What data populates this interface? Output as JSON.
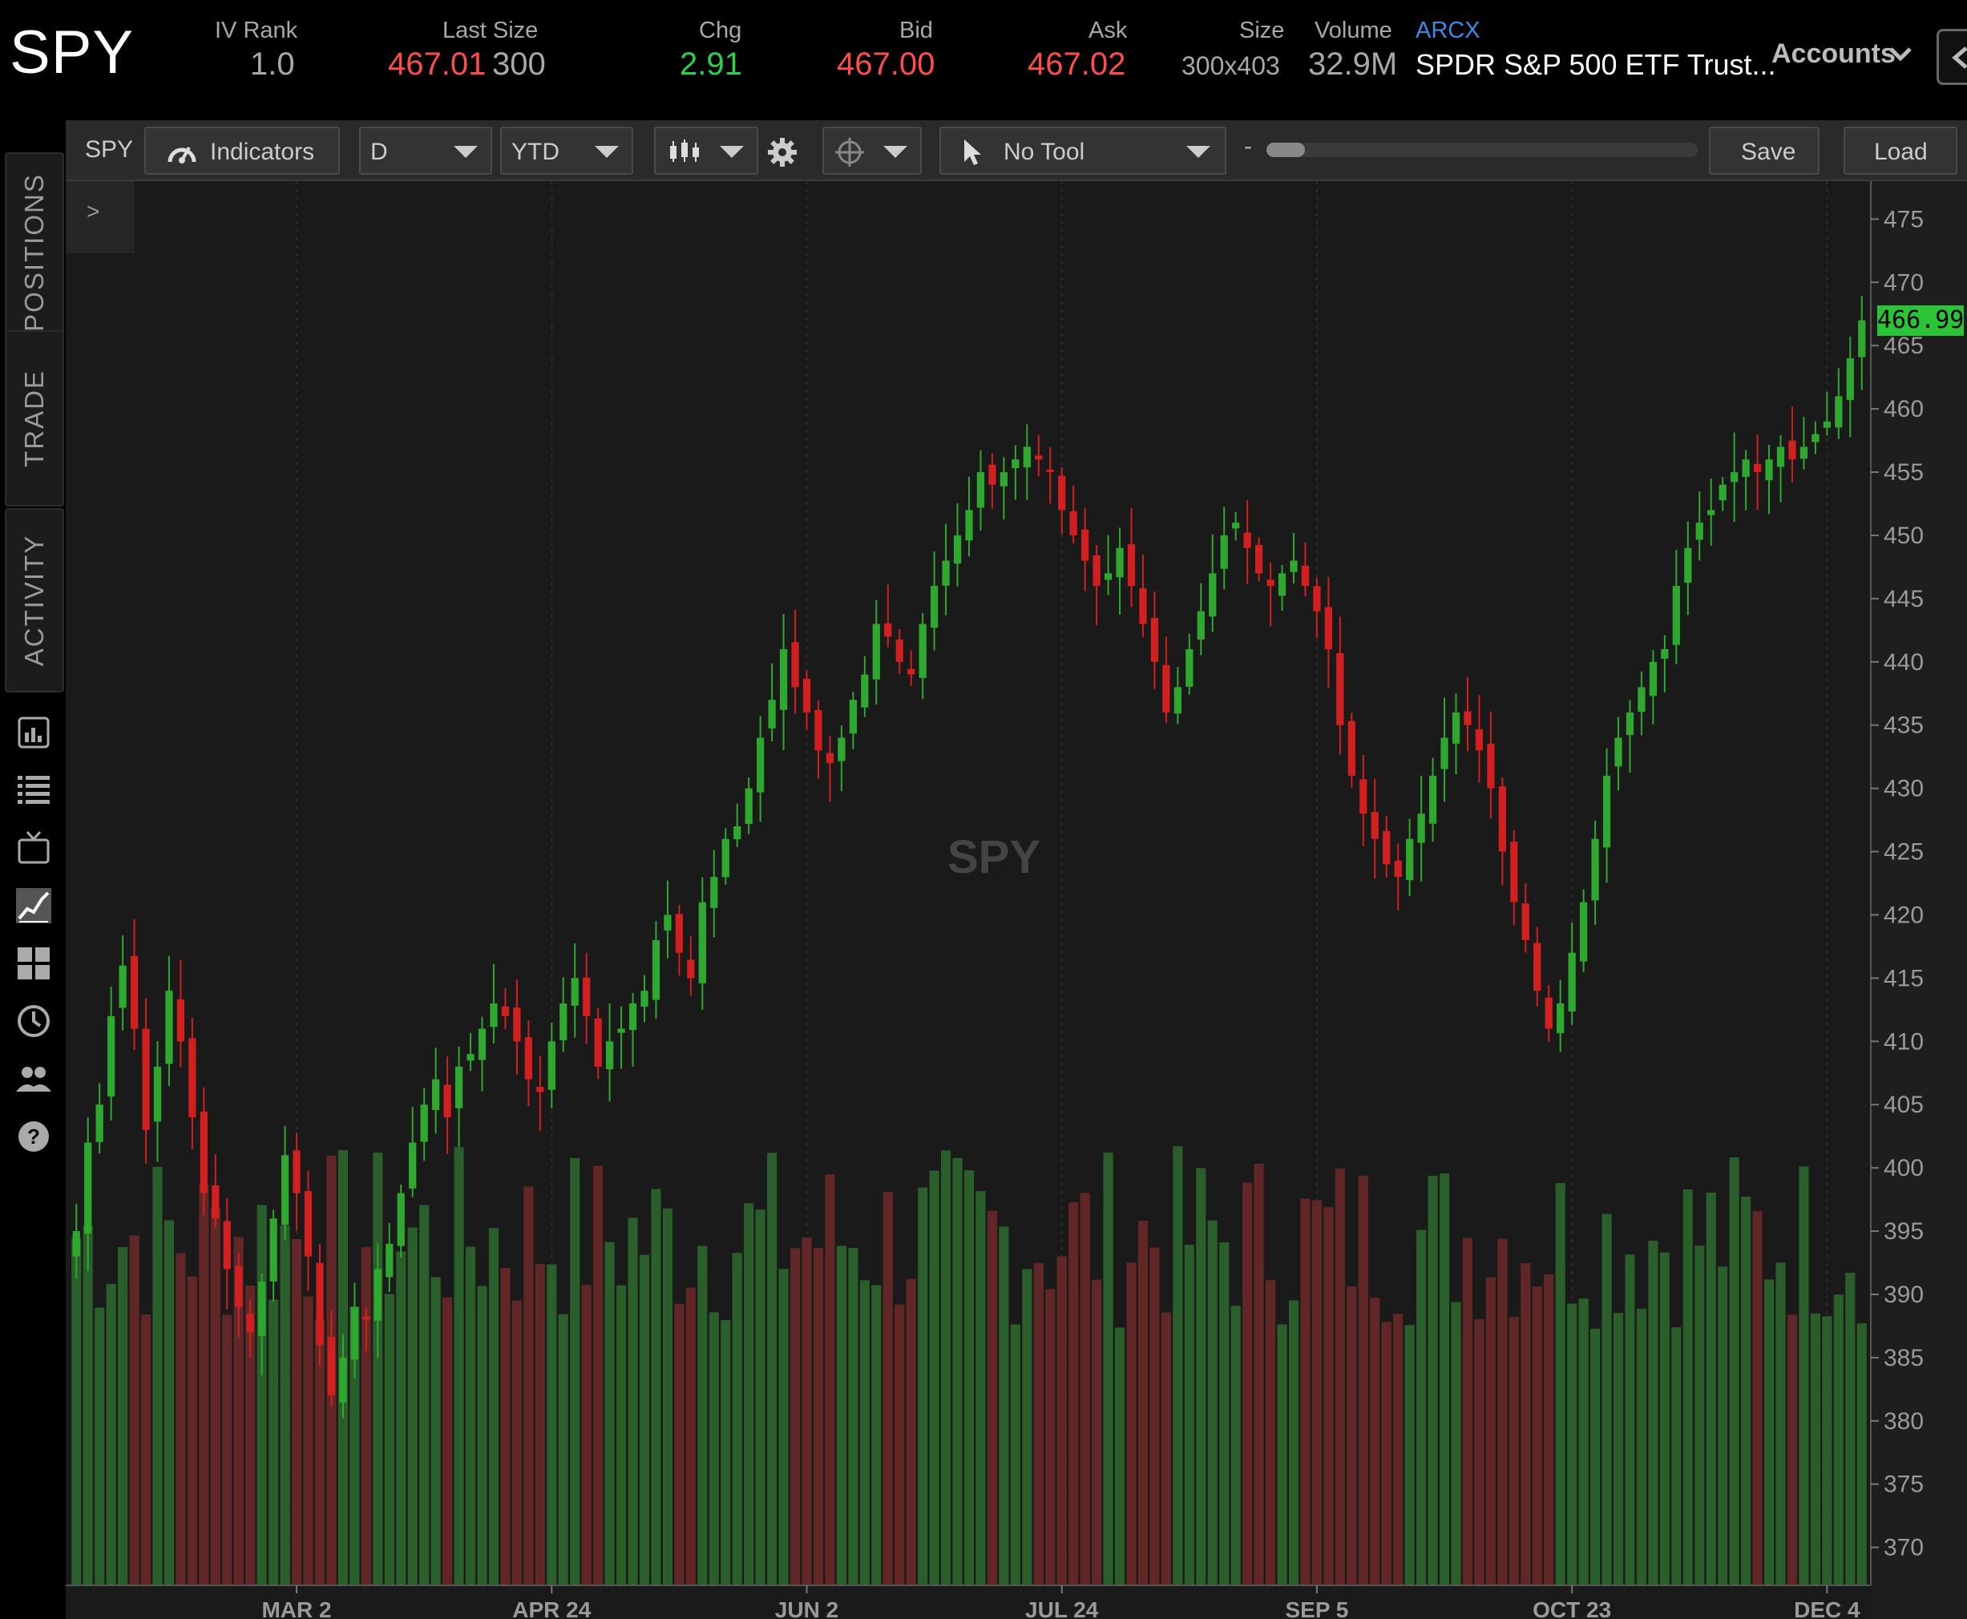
{
  "header": {
    "symbol": "SPY",
    "iv_rank": {
      "label": "IV Rank",
      "value": "1.0"
    },
    "last_size": {
      "label": "Last Size",
      "last": "467.01",
      "size": "300"
    },
    "chg": {
      "label": "Chg",
      "value": "2.91"
    },
    "bid": {
      "label": "Bid",
      "value": "467.00"
    },
    "ask": {
      "label": "Ask",
      "value": "467.02"
    },
    "size": {
      "label": "Size",
      "value": "300x403"
    },
    "volume": {
      "label": "Volume",
      "value": "32.9M"
    },
    "exchange": "ARCX",
    "description": "SPDR S&P 500 ETF Trust...",
    "accounts": "Accounts"
  },
  "sidebar": {
    "tabs": [
      "POSITIONS",
      "TRADE",
      "ACTIVITY"
    ],
    "icons": [
      "dashboard-icon",
      "list-icon",
      "tv-icon",
      "chart-icon",
      "grid-icon",
      "history-icon",
      "community-icon",
      "help-icon"
    ]
  },
  "toolbar": {
    "symbol": "SPY",
    "indicators": "Indicators",
    "aggregation": "D",
    "range": "YTD",
    "tool": "No Tool",
    "zoom_minus": "-",
    "zoom_plus": "+",
    "zoom_level": 0.09,
    "save": "Save",
    "load": "Load"
  },
  "chart": {
    "watermark": "SPY",
    "collapse": ">",
    "last_price_tag": "466.99",
    "colors": {
      "up": "#2fa82f",
      "down": "#d21f1f",
      "vol_up": "#2e6b2e",
      "vol_down": "#6e2a2a",
      "background": "#1a1a1a"
    }
  },
  "chart_data": {
    "type": "candlestick",
    "title": "SPY",
    "y_ticks": [
      475,
      470,
      465,
      460,
      455,
      450,
      445,
      440,
      435,
      430,
      425,
      420,
      415,
      410,
      405,
      400,
      395,
      390,
      385,
      380,
      375,
      370
    ],
    "x_ticks": [
      "MAR 2",
      "APR 24",
      "JUN 2",
      "JUL 24",
      "SEP 5",
      "OCT 23",
      "DEC 4"
    ],
    "ylim": [
      367,
      478
    ],
    "last_price": 466.99,
    "closes": [
      395,
      402,
      405,
      412,
      416,
      411,
      403,
      408,
      414,
      410,
      404,
      398,
      396,
      392,
      389,
      387,
      391,
      396,
      401,
      398,
      393,
      386,
      382,
      385,
      389,
      388,
      392,
      394,
      398,
      402,
      405,
      407,
      404,
      408,
      409,
      411,
      413,
      412,
      410,
      407,
      406,
      410,
      413,
      415,
      412,
      408,
      410,
      411,
      413,
      414,
      418,
      420,
      417,
      415,
      421,
      423,
      426,
      427,
      430,
      434,
      437,
      441,
      438,
      436,
      433,
      432,
      434,
      437,
      439,
      443,
      442,
      440,
      439,
      443,
      446,
      448,
      450,
      452,
      455,
      454,
      455,
      456,
      457,
      456,
      455,
      452,
      450,
      448,
      446,
      447,
      449,
      446,
      443,
      440,
      436,
      438,
      441,
      444,
      447,
      450,
      451,
      449,
      447,
      446,
      447,
      448,
      446,
      444,
      441,
      435,
      431,
      428,
      426,
      424,
      423,
      426,
      428,
      431,
      434,
      436,
      435,
      433,
      430,
      425,
      421,
      418,
      414,
      411,
      413,
      417,
      421,
      426,
      431,
      434,
      436,
      438,
      440,
      441,
      446,
      449,
      451,
      452,
      454,
      455,
      456,
      455,
      456,
      457,
      456,
      457,
      458,
      459,
      461,
      464,
      467
    ],
    "volume_note": "daily volume histogram along the bottom, unscaled"
  }
}
